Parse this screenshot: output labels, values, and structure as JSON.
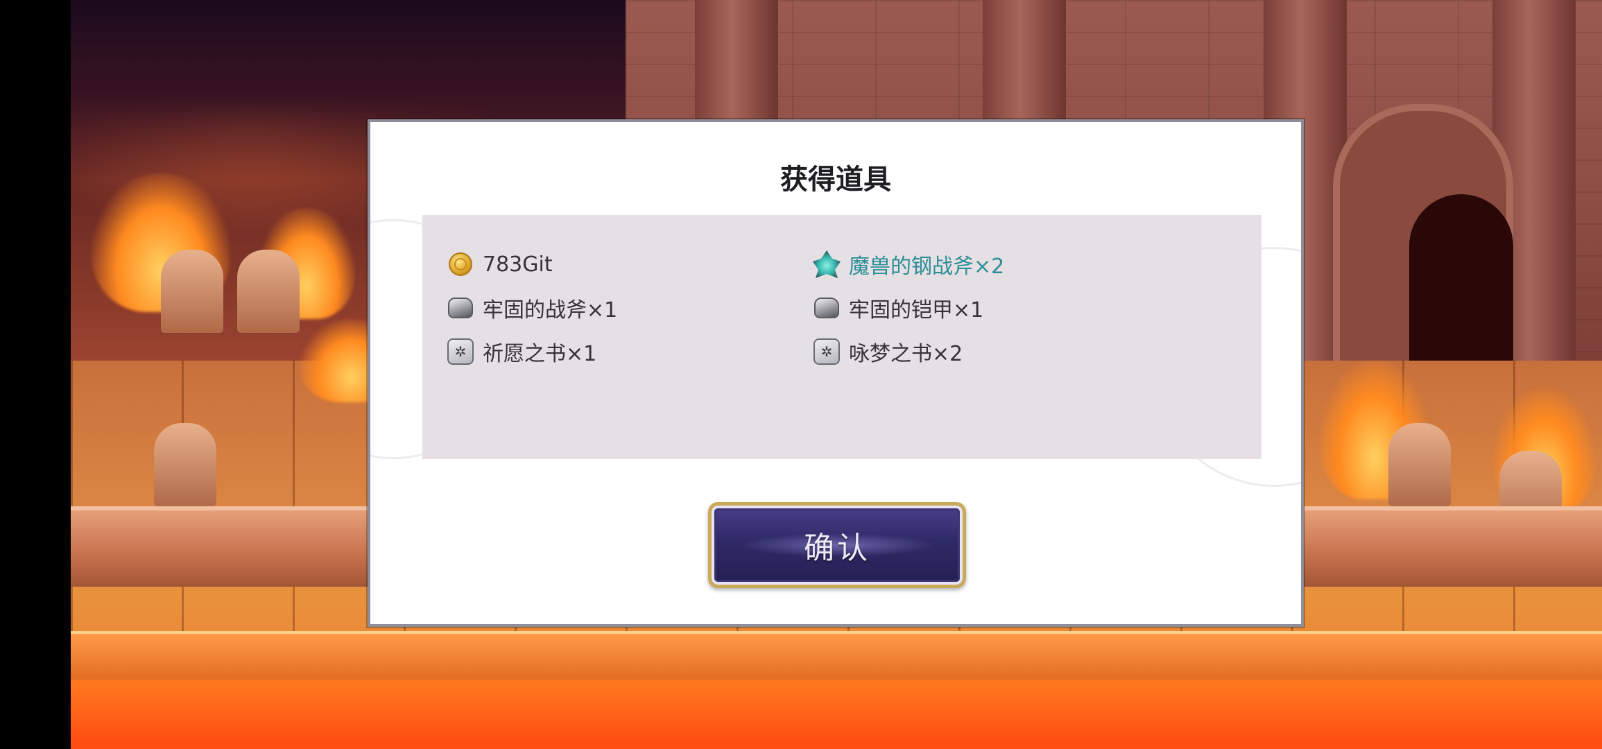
{
  "dialog": {
    "title": "获得道具",
    "confirm_label": "确认"
  },
  "items": [
    {
      "icon": "gold-coin-icon",
      "label": "783Git",
      "highlight": false
    },
    {
      "icon": "crystal-ore-icon",
      "label": "魔兽的钢战斧×2",
      "highlight": true,
      "highlight_color": "#2c8e96"
    },
    {
      "icon": "iron-ore-icon",
      "label": "牢固的战斧×1",
      "highlight": false
    },
    {
      "icon": "iron-ore-icon",
      "label": "牢固的铠甲×1",
      "highlight": false
    },
    {
      "icon": "book-icon",
      "label": "祈愿之书×1",
      "highlight": false
    },
    {
      "icon": "book-icon",
      "label": "咏梦之书×2",
      "highlight": false
    }
  ]
}
